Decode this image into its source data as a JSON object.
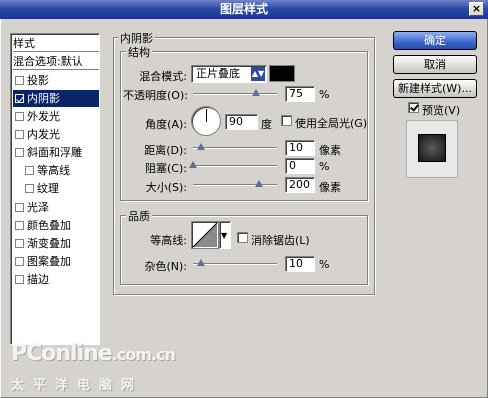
{
  "window": {
    "title": "图层样式",
    "close_label": "×"
  },
  "left_list": {
    "header": "样式",
    "blend_options": "混合选项:默认",
    "items": [
      {
        "label": "投影",
        "checked": false
      },
      {
        "label": "内阴影",
        "checked": true,
        "selected": true
      },
      {
        "label": "外发光",
        "checked": false
      },
      {
        "label": "内发光",
        "checked": false
      },
      {
        "label": "斜面和浮雕",
        "checked": false
      },
      {
        "label": "等高线",
        "checked": false
      },
      {
        "label": "纹理",
        "checked": false
      },
      {
        "label": "光泽",
        "checked": false
      },
      {
        "label": "颜色叠加",
        "checked": false
      },
      {
        "label": "渐变叠加",
        "checked": false
      },
      {
        "label": "图案叠加",
        "checked": false
      },
      {
        "label": "描边",
        "checked": false
      }
    ]
  },
  "inner_shadow": {
    "group_title": "内阴影",
    "structure": {
      "title": "结构",
      "blend_mode_label": "混合模式:",
      "blend_mode_value": "正片叠底",
      "color": "#000000",
      "opacity_label": "不透明度(O):",
      "opacity_value": "75",
      "opacity_unit": "%",
      "opacity_level": 0.75,
      "angle_label": "角度(A):",
      "angle_value": "90",
      "angle_unit": "度",
      "global_light_label": "使用全局光(G)",
      "global_light_checked": false,
      "distance_label": "距离(D):",
      "distance_value": "10",
      "distance_unit": "像素",
      "choke_label": "阻塞(C):",
      "choke_value": "0",
      "choke_unit": "%",
      "size_label": "大小(S):",
      "size_value": "200",
      "size_unit": "像素"
    },
    "quality": {
      "title": "品质",
      "contour_label": "等高线:",
      "anti_alias_label": "消除锯齿(L)",
      "anti_alias_checked": false,
      "noise_label": "杂色(N):",
      "noise_value": "10",
      "noise_unit": "%"
    }
  },
  "buttons": {
    "ok": "确定",
    "cancel": "取消",
    "new_style": "新建样式(W)...",
    "preview_label": "预览(V)",
    "preview_checked": true
  },
  "watermark": {
    "line1": "PConline",
    "line1b": ".com.cn",
    "line2": "太平洋电脑网"
  }
}
